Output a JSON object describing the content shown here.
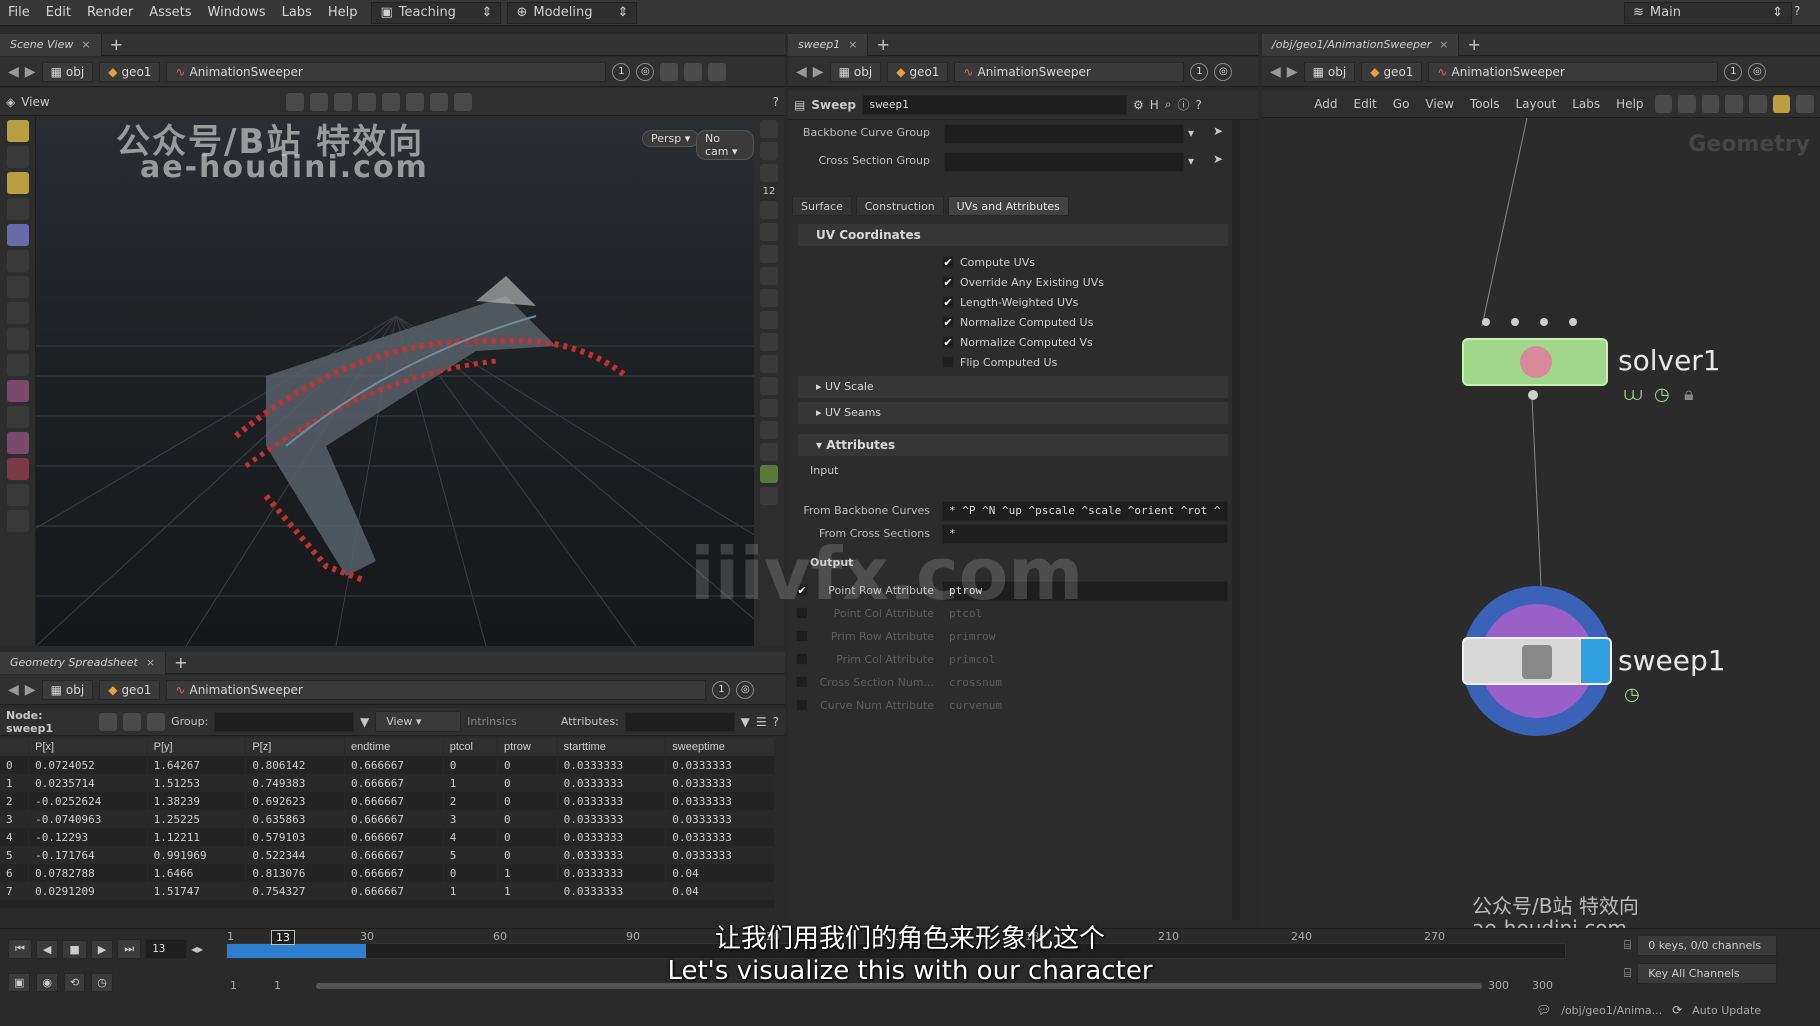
{
  "menubar": {
    "items": [
      "File",
      "Edit",
      "Render",
      "Assets",
      "Windows",
      "Labs",
      "Help"
    ],
    "desktop1": "Teaching",
    "desktop2": "Modeling",
    "main": "Main"
  },
  "scene_view": {
    "tab": "Scene View",
    "path": {
      "obj": "obj",
      "geo": "geo1",
      "node": "AnimationSweeper",
      "num": "1"
    },
    "view_label": "View",
    "persp": "Persp",
    "cam": "No cam",
    "watermark1": "公众号/B站 特效向",
    "watermark2": "ae-houdini.com",
    "side_num": "12"
  },
  "parm_pane": {
    "tab": "sweep1",
    "path": {
      "obj": "obj",
      "geo": "geo1",
      "node": "AnimationSweeper",
      "num": "1"
    },
    "node_type": "Sweep",
    "node_name": "sweep1",
    "backbone_label": "Backbone Curve Group",
    "cross_label": "Cross Section Group",
    "tabs": [
      "Surface",
      "Construction",
      "UVs and Attributes"
    ],
    "uv_section": "UV Coordinates",
    "uv_checks": [
      {
        "label": "Compute UVs",
        "on": true
      },
      {
        "label": "Override Any Existing UVs",
        "on": true
      },
      {
        "label": "Length-Weighted UVs",
        "on": true
      },
      {
        "label": "Normalize Computed Us",
        "on": true
      },
      {
        "label": "Normalize Computed Vs",
        "on": true
      },
      {
        "label": "Flip Computed Us",
        "on": false
      }
    ],
    "uv_scale": "UV Scale",
    "uv_seams": "UV Seams",
    "attr_section": "Attributes",
    "input_label": "Input",
    "from_backbone_label": "From Backbone Curves",
    "from_backbone_value": "* ^P ^N ^up ^pscale ^scale ^orient ^rot ^",
    "from_cross_label": "From Cross Sections",
    "from_cross_value": "*",
    "output_label": "Output",
    "outputs": [
      {
        "label": "Point Row Attribute",
        "value": "ptrow",
        "on": true
      },
      {
        "label": "Point Col Attribute",
        "value": "ptcol",
        "on": false
      },
      {
        "label": "Prim Row Attribute",
        "value": "primrow",
        "on": false
      },
      {
        "label": "Prim Col Attribute",
        "value": "primcol",
        "on": false
      },
      {
        "label": "Cross Section Num...",
        "value": "crossnum",
        "on": false
      },
      {
        "label": "Curve Num Attribute",
        "value": "curvenum",
        "on": false
      }
    ]
  },
  "network": {
    "tab": "/obj/geo1/AnimationSweeper",
    "path": {
      "obj": "obj",
      "geo": "geo1",
      "node": "AnimationSweeper",
      "num": "1"
    },
    "menus": [
      "Add",
      "Edit",
      "Go",
      "View",
      "Tools",
      "Layout",
      "Labs",
      "Help"
    ],
    "context": "Geometry",
    "node1": "solver1",
    "node2": "sweep1",
    "watermark1": "公众号/B站 特效向",
    "watermark2": "ae-houdini.com"
  },
  "spreadsheet": {
    "tab": "Geometry Spreadsheet",
    "path": {
      "obj": "obj",
      "geo": "geo1",
      "node": "AnimationSweeper",
      "num": "1"
    },
    "node_label": "Node: sweep1",
    "group_label": "Group:",
    "view": "View",
    "intrinsics": "Intrinsics",
    "attributes_label": "Attributes:",
    "columns": [
      "",
      "P[x]",
      "P[y]",
      "P[z]",
      "endtime",
      "ptcol",
      "ptrow",
      "starttime",
      "sweeptime"
    ],
    "rows": [
      [
        "0",
        "0.0724052",
        "1.64267",
        "0.806142",
        "0.666667",
        "0",
        "0",
        "0.0333333",
        "0.0333333"
      ],
      [
        "1",
        "0.0235714",
        "1.51253",
        "0.749383",
        "0.666667",
        "1",
        "0",
        "0.0333333",
        "0.0333333"
      ],
      [
        "2",
        "-0.0252624",
        "1.38239",
        "0.692623",
        "0.666667",
        "2",
        "0",
        "0.0333333",
        "0.0333333"
      ],
      [
        "3",
        "-0.0740963",
        "1.25225",
        "0.635863",
        "0.666667",
        "3",
        "0",
        "0.0333333",
        "0.0333333"
      ],
      [
        "4",
        "-0.12293",
        "1.12211",
        "0.579103",
        "0.666667",
        "4",
        "0",
        "0.0333333",
        "0.0333333"
      ],
      [
        "5",
        "-0.171764",
        "0.991969",
        "0.522344",
        "0.666667",
        "5",
        "0",
        "0.0333333",
        "0.0333333"
      ],
      [
        "6",
        "0.0782788",
        "1.6466",
        "0.813076",
        "0.666667",
        "0",
        "1",
        "0.0333333",
        "0.04"
      ],
      [
        "7",
        "0.0291209",
        "1.51747",
        "0.754327",
        "0.666667",
        "1",
        "1",
        "0.0333333",
        "0.04"
      ]
    ]
  },
  "timeline": {
    "frame": "13",
    "marker": "13",
    "ticks": [
      "1",
      "30",
      "60",
      "90",
      "120",
      "150",
      "180",
      "210",
      "240",
      "270"
    ],
    "range_start": "1",
    "range_start2": "1",
    "range_end": "300",
    "range_end2": "300",
    "keys": "0 keys, 0/0 channels",
    "key_all": "Key All Channels",
    "status_path": "/obj/geo1/Anima...",
    "auto_update": "Auto Update",
    "progress_fraction": 0.04
  },
  "subtitles": {
    "zh": "让我们用我们的角色来形象化这个",
    "en": "Let's visualize this with our character"
  },
  "center_watermark": "iiivfx.com",
  "colors": {
    "solver": "#9fd88a",
    "sweep_ring": "#3a63b8",
    "sweep_inner": "#9a5fc8",
    "sweep_bar": "#2f9fe0",
    "timeline_blue": "#2d7fd0"
  }
}
